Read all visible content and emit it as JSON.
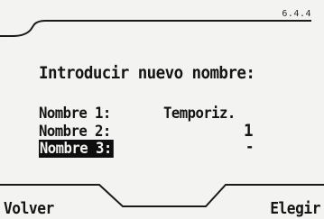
{
  "header": {
    "ref": "6.4.4"
  },
  "prompt": "Introducir nuevo nombre:",
  "rows": [
    {
      "label": "Nombre 1:",
      "value": "Temporiz."
    },
    {
      "label": "Nombre 2:",
      "value": "1"
    },
    {
      "label": "Nombre 3:",
      "value": "-"
    }
  ],
  "softkeys": {
    "left": "Volver",
    "right": "Elegir"
  }
}
